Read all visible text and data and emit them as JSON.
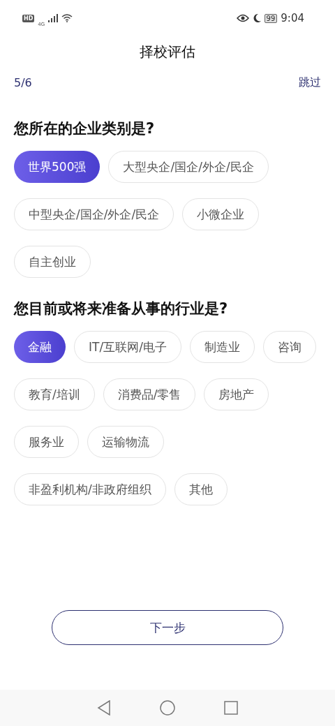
{
  "status_bar": {
    "hd": "HD",
    "network": "4G",
    "battery": "99",
    "time": "9:04"
  },
  "header": {
    "title": "择校评估"
  },
  "progress": {
    "step": "5/6",
    "skip": "跳过"
  },
  "questions": [
    {
      "title": "您所在的企业类别是?",
      "options": [
        {
          "label": "世界500强",
          "selected": true
        },
        {
          "label": "大型央企/国企/外企/民企",
          "selected": false
        },
        {
          "label": "中型央企/国企/外企/民企",
          "selected": false
        },
        {
          "label": "小微企业",
          "selected": false
        },
        {
          "label": "自主创业",
          "selected": false
        }
      ]
    },
    {
      "title": "您目前或将来准备从事的行业是?",
      "options": [
        {
          "label": "金融",
          "selected": true
        },
        {
          "label": "IT/互联网/电子",
          "selected": false
        },
        {
          "label": "制造业",
          "selected": false
        },
        {
          "label": "咨询",
          "selected": false
        },
        {
          "label": "教育/培训",
          "selected": false
        },
        {
          "label": "消费品/零售",
          "selected": false
        },
        {
          "label": "房地产",
          "selected": false
        },
        {
          "label": "服务业",
          "selected": false
        },
        {
          "label": "运输物流",
          "selected": false
        },
        {
          "label": "非盈利机构/非政府组织",
          "selected": false
        },
        {
          "label": "其他",
          "selected": false
        }
      ]
    }
  ],
  "next_button": "下一步"
}
